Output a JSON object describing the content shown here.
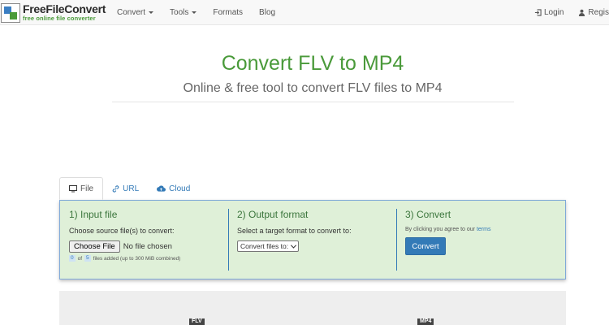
{
  "brand": {
    "name": "FreeFileConvert",
    "tagline": "free online file converter"
  },
  "nav": {
    "convert": "Convert",
    "tools": "Tools",
    "formats": "Formats",
    "blog": "Blog",
    "login": "Login",
    "register": "Regis"
  },
  "header": {
    "title": "Convert FLV to MP4",
    "subtitle": "Online & free tool to convert FLV files to MP4"
  },
  "tabs": [
    {
      "label": "File",
      "icon": "monitor-icon"
    },
    {
      "label": "URL",
      "icon": "link-icon"
    },
    {
      "label": "Cloud",
      "icon": "cloud-upload-icon"
    }
  ],
  "step1": {
    "title": "1) Input file",
    "label": "Choose source file(s) to convert:",
    "choose_button": "Choose File",
    "no_file": "No file chosen",
    "count": "0",
    "of": "of",
    "max": "5",
    "files_added": "files added (up to 300 MiB combined)"
  },
  "step2": {
    "title": "2) Output format",
    "label": "Select a target format to convert to:",
    "select_value": "Convert files to:"
  },
  "step3": {
    "title": "3) Convert",
    "agree_text": "By clicking you agree to our",
    "terms_link": "terms",
    "convert_button": "Convert"
  },
  "preview": {
    "from_tag": "FLV",
    "to_tag": "MP4"
  },
  "colors": {
    "accent_green": "#4a9a3a",
    "link_blue": "#337ab7",
    "panel_bg": "#dff0d8"
  }
}
